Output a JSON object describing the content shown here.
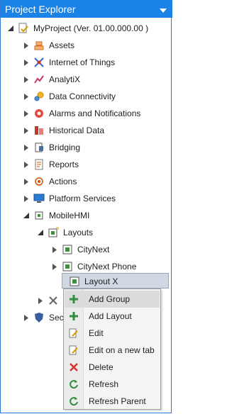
{
  "panel": {
    "title": "Project Explorer"
  },
  "tree": {
    "root": "MyProject (Ver. 01.00.000.00 )",
    "items": [
      {
        "label": "Assets",
        "icon": "assets-icon"
      },
      {
        "label": "Internet of Things",
        "icon": "iot-icon"
      },
      {
        "label": "AnalytiX",
        "icon": "analytix-icon"
      },
      {
        "label": "Data Connectivity",
        "icon": "data-connectivity-icon"
      },
      {
        "label": "Alarms and Notifications",
        "icon": "alarms-icon"
      },
      {
        "label": "Historical Data",
        "icon": "historical-data-icon"
      },
      {
        "label": "Bridging",
        "icon": "bridging-icon"
      },
      {
        "label": "Reports",
        "icon": "reports-icon"
      },
      {
        "label": "Actions",
        "icon": "actions-icon"
      },
      {
        "label": "Platform Services",
        "icon": "platform-services-icon"
      },
      {
        "label": "MobileHMI",
        "icon": "mobilehmi-icon"
      }
    ],
    "layouts": {
      "label": "Layouts"
    },
    "layout_children": [
      {
        "label": "CityNext"
      },
      {
        "label": "CityNext Phone"
      },
      {
        "label": "Layout X"
      }
    ],
    "partial": {
      "label": "Sec"
    }
  },
  "context_menu": {
    "items": [
      {
        "label": "Add Group",
        "icon": "add-icon"
      },
      {
        "label": "Add Layout",
        "icon": "add-icon"
      },
      {
        "label": "Edit",
        "icon": "edit-icon"
      },
      {
        "label": "Edit on a new tab",
        "icon": "edit-new-tab-icon"
      },
      {
        "label": "Delete",
        "icon": "delete-icon"
      },
      {
        "label": "Refresh",
        "icon": "refresh-icon"
      },
      {
        "label": "Refresh Parent",
        "icon": "refresh-icon"
      }
    ]
  },
  "colors": {
    "titlebar": "#1c83e6",
    "selection": "#cfd8e3",
    "menu_hover": "#dcdcdc"
  }
}
